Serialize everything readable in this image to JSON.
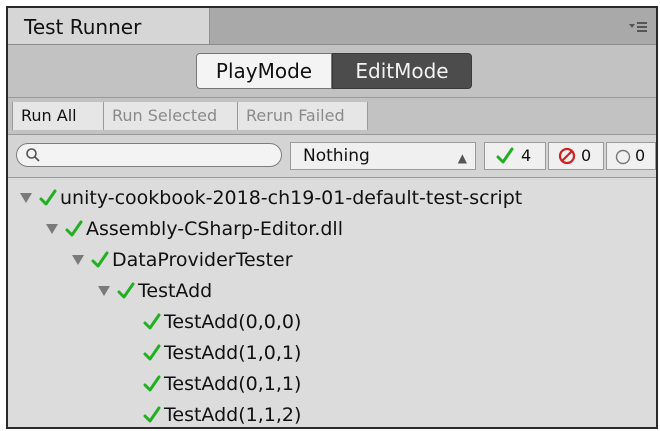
{
  "window": {
    "tab_title": "Test Runner"
  },
  "modes": {
    "play_label": "PlayMode",
    "edit_label": "EditMode",
    "active": "EditMode"
  },
  "toolbar": {
    "run_all": "Run All",
    "run_selected": "Run Selected",
    "rerun_failed": "Rerun Failed"
  },
  "filter": {
    "search_value": "",
    "category_selected": "Nothing",
    "passed_count": "4",
    "failed_count": "0",
    "not_run_count": "0"
  },
  "colors": {
    "pass_green": "#20b020",
    "fail_red": "#d02020",
    "active_mode_bg": "#4c4c4c"
  },
  "tree": [
    {
      "label": "unity-cookbook-2018-ch19-01-default-test-script",
      "depth": 0,
      "expanded": true,
      "status": "passed"
    },
    {
      "label": "Assembly-CSharp-Editor.dll",
      "depth": 1,
      "expanded": true,
      "status": "passed"
    },
    {
      "label": "DataProviderTester",
      "depth": 2,
      "expanded": true,
      "status": "passed"
    },
    {
      "label": "TestAdd",
      "depth": 3,
      "expanded": true,
      "status": "passed"
    },
    {
      "label": "TestAdd(0,0,0)",
      "depth": 4,
      "expanded": false,
      "status": "passed"
    },
    {
      "label": "TestAdd(1,0,1)",
      "depth": 4,
      "expanded": false,
      "status": "passed"
    },
    {
      "label": "TestAdd(0,1,1)",
      "depth": 4,
      "expanded": false,
      "status": "passed"
    },
    {
      "label": "TestAdd(1,1,2)",
      "depth": 4,
      "expanded": false,
      "status": "passed"
    }
  ]
}
